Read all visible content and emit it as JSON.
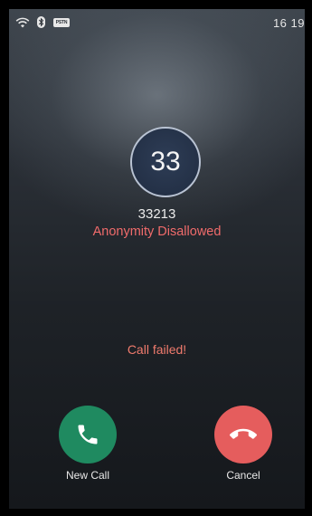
{
  "status_bar": {
    "icons": [
      "wifi-icon",
      "bluetooth-icon",
      "pstn-icon"
    ],
    "pstn_label": "PSTN",
    "time": "16 19"
  },
  "call": {
    "avatar_text": "33",
    "number": "33213",
    "reason": "Anonymity Disallowed",
    "status": "Call failed!"
  },
  "actions": {
    "new_call": {
      "label": "New Call",
      "icon": "phone-icon",
      "color": "#1f8a60"
    },
    "cancel": {
      "label": "Cancel",
      "icon": "hang-up-icon",
      "color": "#e55d5d"
    }
  },
  "colors": {
    "error_text": "#f06b6b"
  }
}
